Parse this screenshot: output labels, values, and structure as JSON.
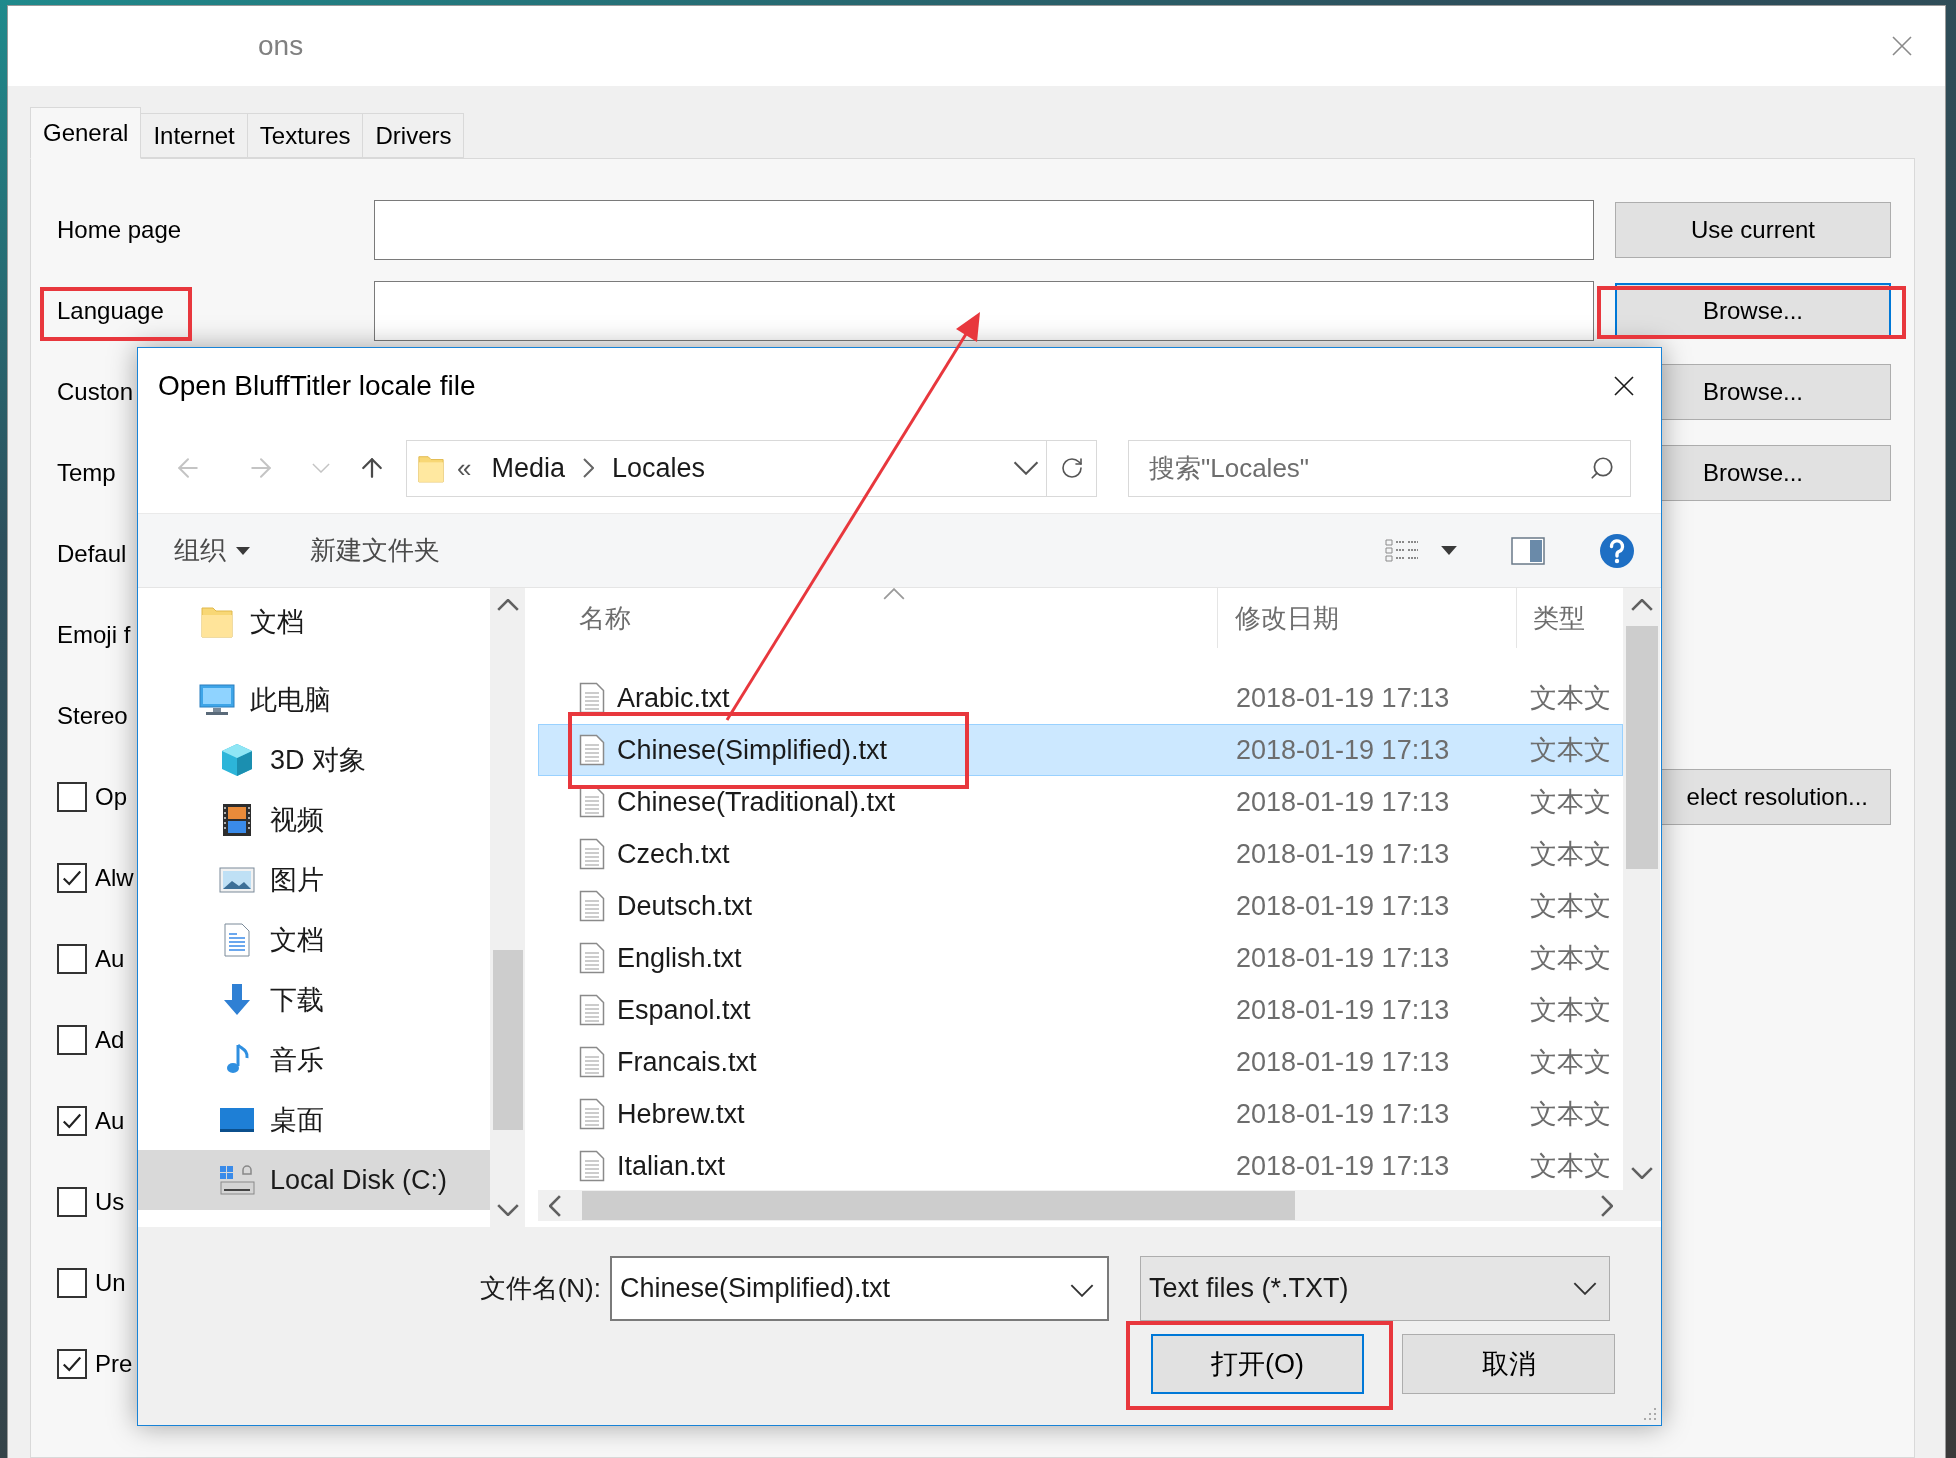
{
  "options_window": {
    "title": "ons",
    "tabs": [
      {
        "label": "General",
        "selected": true
      },
      {
        "label": "Internet",
        "selected": false
      },
      {
        "label": "Textures",
        "selected": false
      },
      {
        "label": "Drivers",
        "selected": false
      }
    ],
    "rows": [
      {
        "kind": "field",
        "label": "Home page",
        "button": "Use current",
        "focused": false
      },
      {
        "kind": "field",
        "label": "Language",
        "button": "Browse...",
        "focused": true
      },
      {
        "kind": "button",
        "label": "Custon",
        "button": "Browse...",
        "focused": false
      },
      {
        "kind": "button",
        "label": "Temp",
        "button": "Browse...",
        "focused": false
      },
      {
        "kind": "label",
        "label": "Defaul"
      },
      {
        "kind": "label",
        "label": "Emoji f"
      },
      {
        "kind": "label",
        "label": "Stereo"
      },
      {
        "kind": "checkbox",
        "label": "Op",
        "checked": false,
        "button": "elect resolution...",
        "focused": false
      },
      {
        "kind": "checkbox",
        "label": "Alw",
        "checked": true
      },
      {
        "kind": "checkbox",
        "label": "Au",
        "checked": false
      },
      {
        "kind": "checkbox",
        "label": "Ad",
        "checked": false
      },
      {
        "kind": "checkbox",
        "label": "Au",
        "checked": true
      },
      {
        "kind": "checkbox",
        "label": "Us",
        "checked": false
      },
      {
        "kind": "checkbox",
        "label": "Un",
        "checked": false
      },
      {
        "kind": "checkbox",
        "label": "Pre",
        "checked": true
      }
    ]
  },
  "file_dialog": {
    "title": "Open BluffTitler locale file",
    "address": {
      "overflow": "«",
      "segments": [
        "Media",
        "Locales"
      ]
    },
    "search": {
      "placeholder": "搜索\"Locales\""
    },
    "commands": [
      {
        "label": "组织",
        "menu": true
      },
      {
        "label": "新建文件夹",
        "menu": false
      }
    ],
    "nav_pane": [
      {
        "label": "文档",
        "kind": "folder",
        "selected": false
      },
      {
        "label": "此电脑",
        "kind": "computer",
        "selected": false,
        "children": [
          {
            "label": "3D 对象",
            "kind": "objects3d",
            "selected": false
          },
          {
            "label": "视频",
            "kind": "videos",
            "selected": false
          },
          {
            "label": "图片",
            "kind": "pictures",
            "selected": false
          },
          {
            "label": "文档",
            "kind": "documents",
            "selected": false
          },
          {
            "label": "下载",
            "kind": "downloads",
            "selected": false
          },
          {
            "label": "音乐",
            "kind": "music",
            "selected": false
          },
          {
            "label": "桌面",
            "kind": "desktop",
            "selected": false
          },
          {
            "label": "Local Disk (C:)",
            "kind": "drive",
            "selected": true
          }
        ]
      }
    ],
    "columns": [
      "名称",
      "修改日期",
      "类型"
    ],
    "files": [
      {
        "name": "Arabic.txt",
        "date": "2018-01-19 17:13",
        "type": "文本文",
        "selected": false
      },
      {
        "name": "Chinese(Simplified).txt",
        "date": "2018-01-19 17:13",
        "type": "文本文",
        "selected": true
      },
      {
        "name": "Chinese(Traditional).txt",
        "date": "2018-01-19 17:13",
        "type": "文本文",
        "selected": false
      },
      {
        "name": "Czech.txt",
        "date": "2018-01-19 17:13",
        "type": "文本文",
        "selected": false
      },
      {
        "name": "Deutsch.txt",
        "date": "2018-01-19 17:13",
        "type": "文本文",
        "selected": false
      },
      {
        "name": "English.txt",
        "date": "2018-01-19 17:13",
        "type": "文本文",
        "selected": false
      },
      {
        "name": "Espanol.txt",
        "date": "2018-01-19 17:13",
        "type": "文本文",
        "selected": false
      },
      {
        "name": "Francais.txt",
        "date": "2018-01-19 17:13",
        "type": "文本文",
        "selected": false
      },
      {
        "name": "Hebrew.txt",
        "date": "2018-01-19 17:13",
        "type": "文本文",
        "selected": false
      },
      {
        "name": "Italian.txt",
        "date": "2018-01-19 17:13",
        "type": "文本文",
        "selected": false
      }
    ],
    "file_name": {
      "label": "文件名(N):",
      "value": "Chinese(Simplified).txt"
    },
    "file_type": "Text files (*.TXT)",
    "buttons": [
      {
        "label": "打开(O)",
        "default": true
      },
      {
        "label": "取消",
        "default": false
      }
    ]
  }
}
